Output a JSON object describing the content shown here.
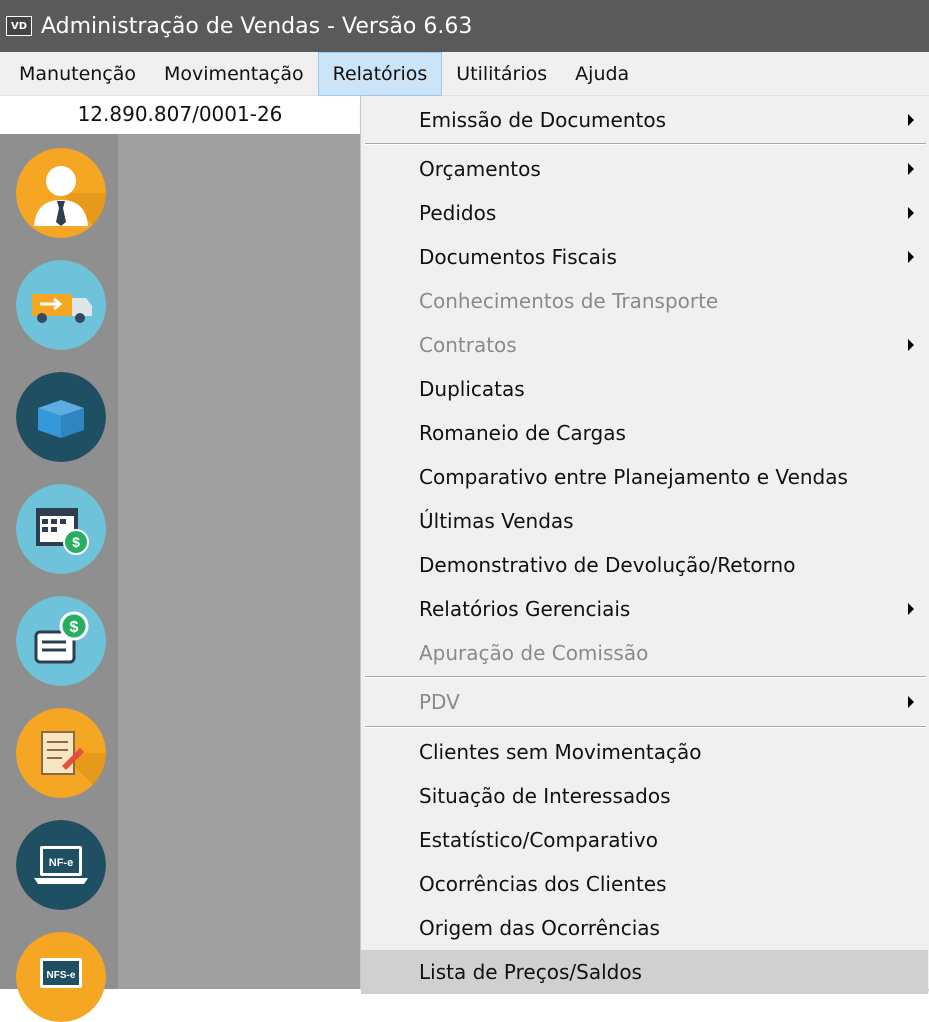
{
  "window": {
    "title": "Administração de Vendas - Versão 6.63",
    "app_icon_text": "VD"
  },
  "menubar": {
    "items": [
      {
        "label": "Manutenção"
      },
      {
        "label": "Movimentação"
      },
      {
        "label": "Relatórios"
      },
      {
        "label": "Utilitários"
      },
      {
        "label": "Ajuda"
      }
    ]
  },
  "company": {
    "cnpj": "12.890.807/0001-26"
  },
  "sidebar": {
    "icons": [
      {
        "name": "clientes-icon"
      },
      {
        "name": "transporte-icon"
      },
      {
        "name": "produtos-icon"
      },
      {
        "name": "financeiro-calendario-icon"
      },
      {
        "name": "pagamentos-icon"
      },
      {
        "name": "contratos-icon"
      },
      {
        "name": "nfe-icon",
        "text": "NF-e"
      },
      {
        "name": "nfse-icon",
        "text": "NFS-e"
      }
    ]
  },
  "dropdown": {
    "items": [
      {
        "label": "Emissão de Documentos",
        "submenu": true
      },
      {
        "label": "Orçamentos",
        "submenu": true
      },
      {
        "label": "Pedidos",
        "submenu": true
      },
      {
        "label": "Documentos Fiscais",
        "submenu": true
      },
      {
        "label": "Conhecimentos de Transporte",
        "disabled": true
      },
      {
        "label": "Contratos",
        "disabled": true,
        "submenu": true
      },
      {
        "label": "Duplicatas"
      },
      {
        "label": "Romaneio de Cargas"
      },
      {
        "label": "Comparativo entre Planejamento e Vendas"
      },
      {
        "label": "Últimas Vendas"
      },
      {
        "label": "Demonstrativo de Devolução/Retorno"
      },
      {
        "label": "Relatórios Gerenciais",
        "submenu": true
      },
      {
        "label": "Apuração de Comissão",
        "disabled": true
      },
      {
        "label": "PDV",
        "disabled": true,
        "submenu": true
      },
      {
        "label": "Clientes sem Movimentação"
      },
      {
        "label": "Situação de Interessados"
      },
      {
        "label": "Estatístico/Comparativo"
      },
      {
        "label": "Ocorrências dos Clientes"
      },
      {
        "label": "Origem das Ocorrências"
      },
      {
        "label": "Lista de Preços/Saldos",
        "highlighted": true
      }
    ]
  }
}
